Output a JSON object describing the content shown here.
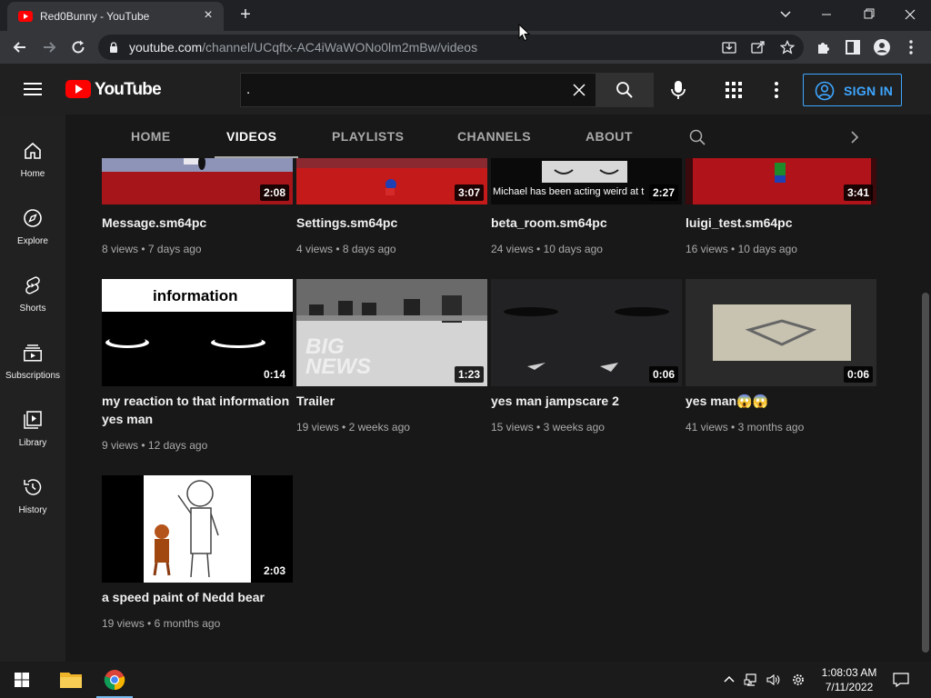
{
  "browser": {
    "tab_title": "Red0Bunny - YouTube",
    "url_host": "youtube.com",
    "url_path": "/channel/UCqftx-AC4iWaWONo0lm2mBw/videos"
  },
  "masthead": {
    "logo_text": "YouTube",
    "search_value": ".",
    "signin_label": "SIGN IN"
  },
  "guide": [
    {
      "label": "Home",
      "icon": "home-icon"
    },
    {
      "label": "Explore",
      "icon": "compass-icon"
    },
    {
      "label": "Shorts",
      "icon": "shorts-icon"
    },
    {
      "label": "Subscriptions",
      "icon": "subscriptions-icon"
    },
    {
      "label": "Library",
      "icon": "library-icon"
    },
    {
      "label": "History",
      "icon": "history-icon"
    }
  ],
  "channel_tabs": [
    {
      "label": "HOME",
      "active": false
    },
    {
      "label": "VIDEOS",
      "active": true
    },
    {
      "label": "PLAYLISTS",
      "active": false
    },
    {
      "label": "CHANNELS",
      "active": false
    },
    {
      "label": "ABOUT",
      "active": false
    }
  ],
  "videos": [
    {
      "title": "Message.sm64pc",
      "duration": "2:08",
      "views": "8 views",
      "age": "7 days ago"
    },
    {
      "title": "Settings.sm64pc",
      "duration": "3:07",
      "views": "4 views",
      "age": "8 days ago"
    },
    {
      "title": "beta_room.sm64pc",
      "duration": "2:27",
      "views": "24 views",
      "age": "10 days ago",
      "thumb_caption": "Michael has been acting weird at t"
    },
    {
      "title": "luigi_test.sm64pc",
      "duration": "3:41",
      "views": "16 views",
      "age": "10 days ago"
    },
    {
      "title": "my reaction to that information yes man",
      "duration": "0:14",
      "views": "9 views",
      "age": "12 days ago",
      "thumb_caption": "information"
    },
    {
      "title": "Trailer",
      "duration": "1:23",
      "views": "19 views",
      "age": "2 weeks ago",
      "thumb_caption": "BIG NEWS"
    },
    {
      "title": "yes man jampscare 2",
      "duration": "0:06",
      "views": "15 views",
      "age": "3 weeks ago"
    },
    {
      "title": "yes man😱😱",
      "duration": "0:06",
      "views": "41 views",
      "age": "3 months ago"
    },
    {
      "title": "a speed paint of Nedd bear",
      "duration": "2:03",
      "views": "19 views",
      "age": "6 months ago"
    }
  ],
  "taskbar": {
    "time": "1:08:03 AM",
    "date": "7/11/2022"
  },
  "colors": {
    "accent_blue": "#3ea6ff",
    "youtube_red": "#ff0000",
    "background": "#181818"
  }
}
